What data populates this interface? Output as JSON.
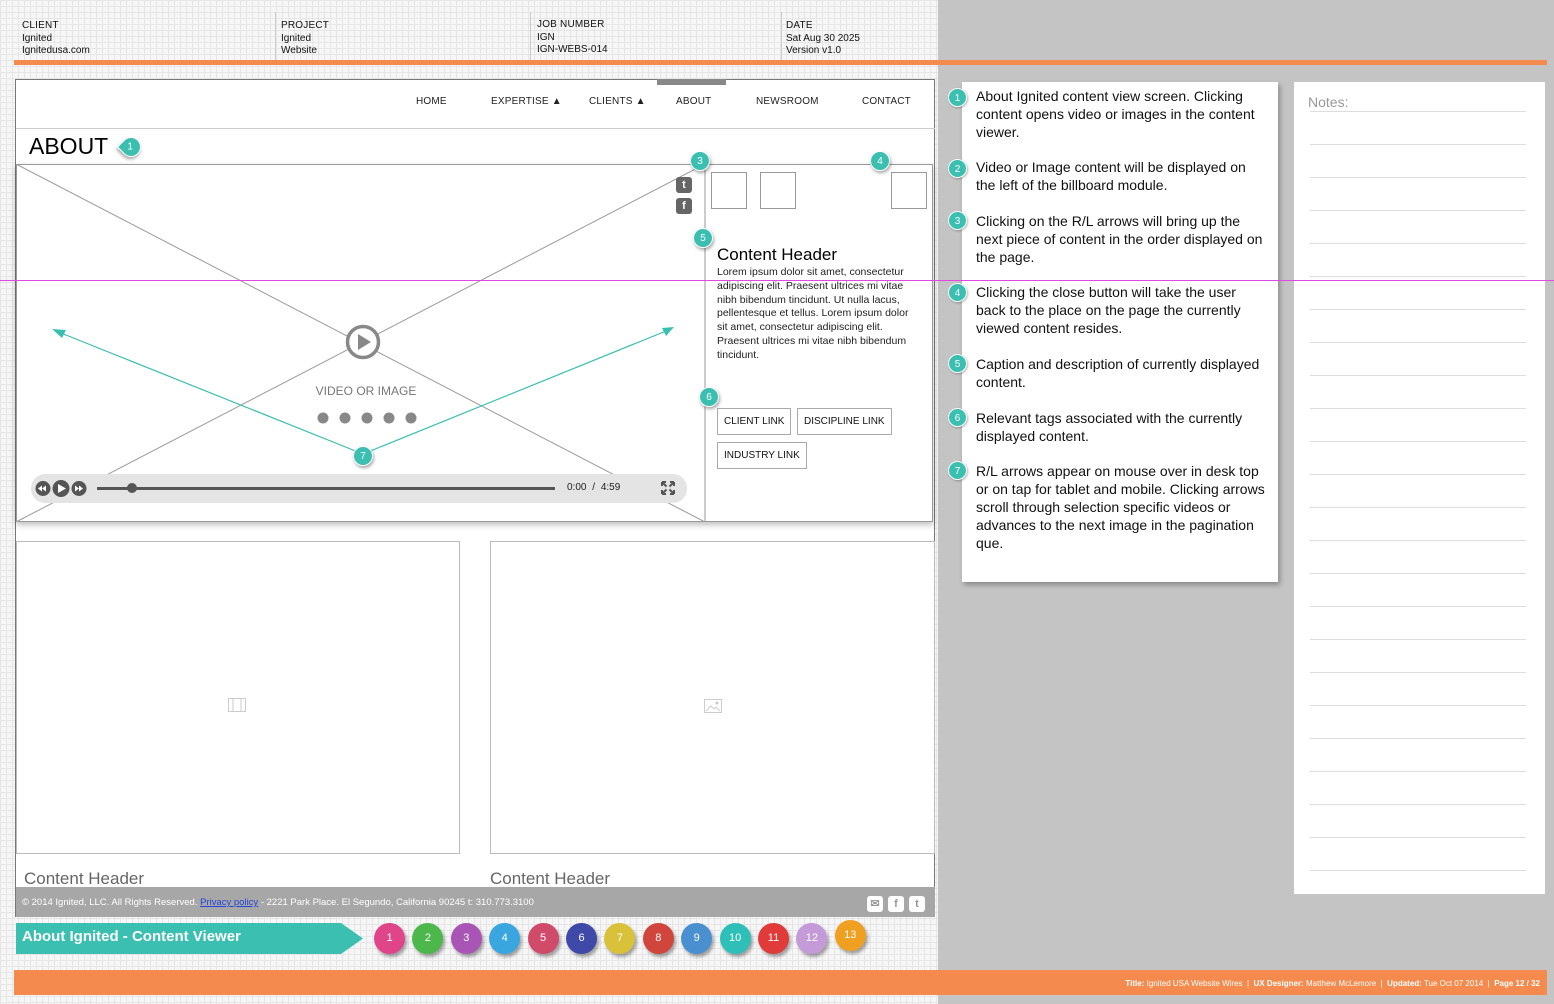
{
  "header": {
    "client": {
      "label": "CLIENT",
      "line1": "Ignited",
      "line2": "Ignitedusa.com"
    },
    "project": {
      "label": "PROJECT",
      "line1": "Ignited",
      "line2": "Website"
    },
    "job": {
      "label": "JOB NUMBER",
      "line1": "IGN",
      "line2": "IGN-WEBS-014"
    },
    "date": {
      "label": "DATE",
      "line1": "Sat Aug 30 2025",
      "line2": "Version v1.0"
    }
  },
  "nav": {
    "home": "HOME",
    "expertise": "EXPERTISE ▲",
    "clients": "CLIENTS ▲",
    "about": "ABOUT",
    "newsroom": "NEWSROOM",
    "contact": "CONTACT"
  },
  "page_title": "ABOUT",
  "viewer": {
    "media_label": "VIDEO OR IMAGE",
    "time_current": "0:00",
    "time_separator": "/",
    "time_total": "4:59",
    "content_header": "Content Header",
    "description": "Lorem ipsum dolor sit amet, consectetur adipiscing elit. Praesent ultrices mi vitae nibh bibendum tincidunt. Ut nulla lacus, pellentesque et tellus. Lorem ipsum dolor sit amet, consectetur adipiscing elit. Praesent ultrices mi vitae nibh bibendum tincidunt.",
    "tags": {
      "client": "CLIENT LINK",
      "discipline": "DISCIPLINE LINK",
      "industry": "INDUSTRY LINK"
    },
    "icons": [
      "twitter-icon",
      "facebook-icon",
      "play-icon",
      "rewind-icon",
      "fast-forward-icon",
      "fullscreen-icon"
    ]
  },
  "panels": {
    "left_header": "Content Header",
    "right_header": "Content Header",
    "left_icon": "film-icon",
    "right_icon": "image-icon"
  },
  "footer": {
    "copyright": "© 2014 Ignited, LLC. All Rights Reserved.",
    "privacy": "Privacy policy",
    "address": "-  2221 Park Place. El Segundo, California 90245 t: 310.773.3100"
  },
  "banner": {
    "title": "About Ignited - Content Viewer"
  },
  "markers": {
    "m1": "1",
    "m2": "2",
    "m3": "3",
    "m4": "4",
    "m5": "5",
    "m6": "6",
    "m7": "7"
  },
  "page_dots": [
    {
      "label": "1",
      "color": "#e0458a"
    },
    {
      "label": "2",
      "color": "#4cb84c"
    },
    {
      "label": "3",
      "color": "#a855b5"
    },
    {
      "label": "4",
      "color": "#3aa6e0"
    },
    {
      "label": "5",
      "color": "#d04a6a"
    },
    {
      "label": "6",
      "color": "#3f4aa8"
    },
    {
      "label": "7",
      "color": "#d9c23a"
    },
    {
      "label": "8",
      "color": "#d0463c"
    },
    {
      "label": "9",
      "color": "#4a8fd0"
    },
    {
      "label": "10",
      "color": "#2ec0b8"
    },
    {
      "label": "11",
      "color": "#e03a3a"
    },
    {
      "label": "12",
      "color": "#c49ad8"
    },
    {
      "label": "13",
      "color": "#f0a020"
    }
  ],
  "annotations": [
    {
      "num": "1",
      "text": "About Ignited content view screen. Clicking content opens video or images in the content viewer."
    },
    {
      "num": "2",
      "text": "Video or Image content will be displayed on the left of the billboard module."
    },
    {
      "num": "3",
      "text": "Clicking on the R/L arrows will bring up the next piece of content in the order displayed on the page."
    },
    {
      "num": "4",
      "text": "Clicking the close button will take the user back to the place on the page the currently viewed content resides."
    },
    {
      "num": "5",
      "text": "Caption and description of currently displayed content."
    },
    {
      "num": "6",
      "text": "Relevant tags associated with the currently displayed content."
    },
    {
      "num": "7",
      "text": "R/L arrows appear on mouse over in desk top or on tap for tablet and mobile. Clicking arrows scroll through selection specific videos or advances to the next image in the pagination que."
    }
  ],
  "notes": {
    "title": "Notes:"
  },
  "bottom": {
    "title_label": "Title:",
    "title_value": "Ignited USA Website Wires",
    "designer_label": "UX Designer:",
    "designer_value": "Matthew McLemore",
    "updated_label": "Updated:",
    "updated_value": "Tue Oct 07 2014",
    "page_label": "Page 12 / 32"
  },
  "colors": {
    "accent": "#3bbfb0",
    "orange": "#f48a4d",
    "guide": "#e247e2"
  }
}
